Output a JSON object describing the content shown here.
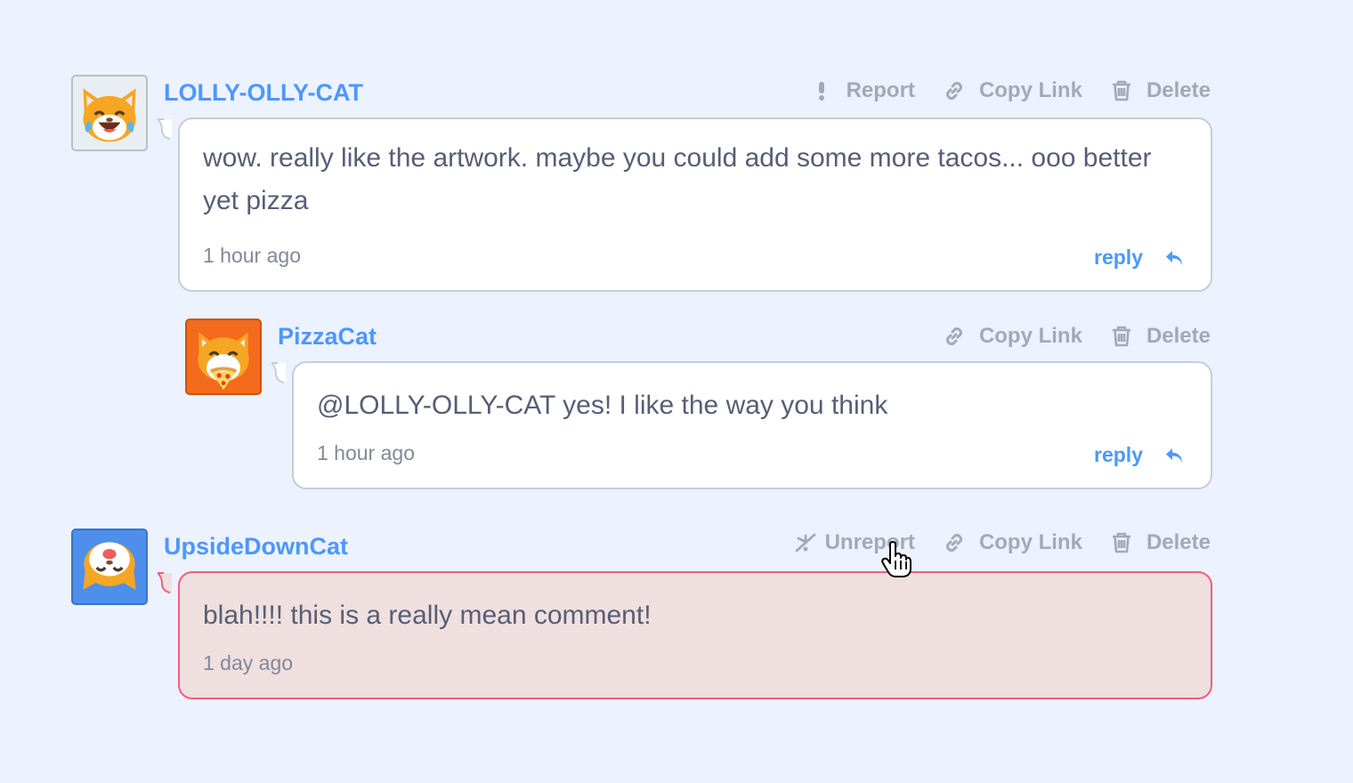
{
  "comments": [
    {
      "username": "LOLLY-OLLY-CAT",
      "avatar_icon": "cat-tears-of-joy-icon",
      "actions": {
        "report": "Report",
        "copy_link": "Copy Link",
        "delete": "Delete"
      },
      "text": "wow. really like the artwork. maybe you could add some more tacos... ooo better yet pizza",
      "time": "1 hour ago",
      "reply_label": "reply",
      "replies": [
        {
          "username": "PizzaCat",
          "avatar_icon": "cat-eating-pizza-icon",
          "actions": {
            "copy_link": "Copy Link",
            "delete": "Delete"
          },
          "text": "@LOLLY-OLLY-CAT yes! I like the way you think",
          "time": "1 hour ago",
          "reply_label": "reply"
        }
      ]
    },
    {
      "username": "UpsideDownCat",
      "avatar_icon": "upside-down-cat-icon",
      "reported": true,
      "actions": {
        "unreport": "Unreport",
        "copy_link": "Copy Link",
        "delete": "Delete"
      },
      "text": "blah!!!! this is a really mean comment!",
      "time": "1 day ago"
    }
  ],
  "colors": {
    "background": "#ecf2fe",
    "link_blue": "#4d97ff",
    "action_gray": "#a2a9b7",
    "reported_bg": "#efdfdf",
    "reported_border": "#ef5f7d"
  }
}
